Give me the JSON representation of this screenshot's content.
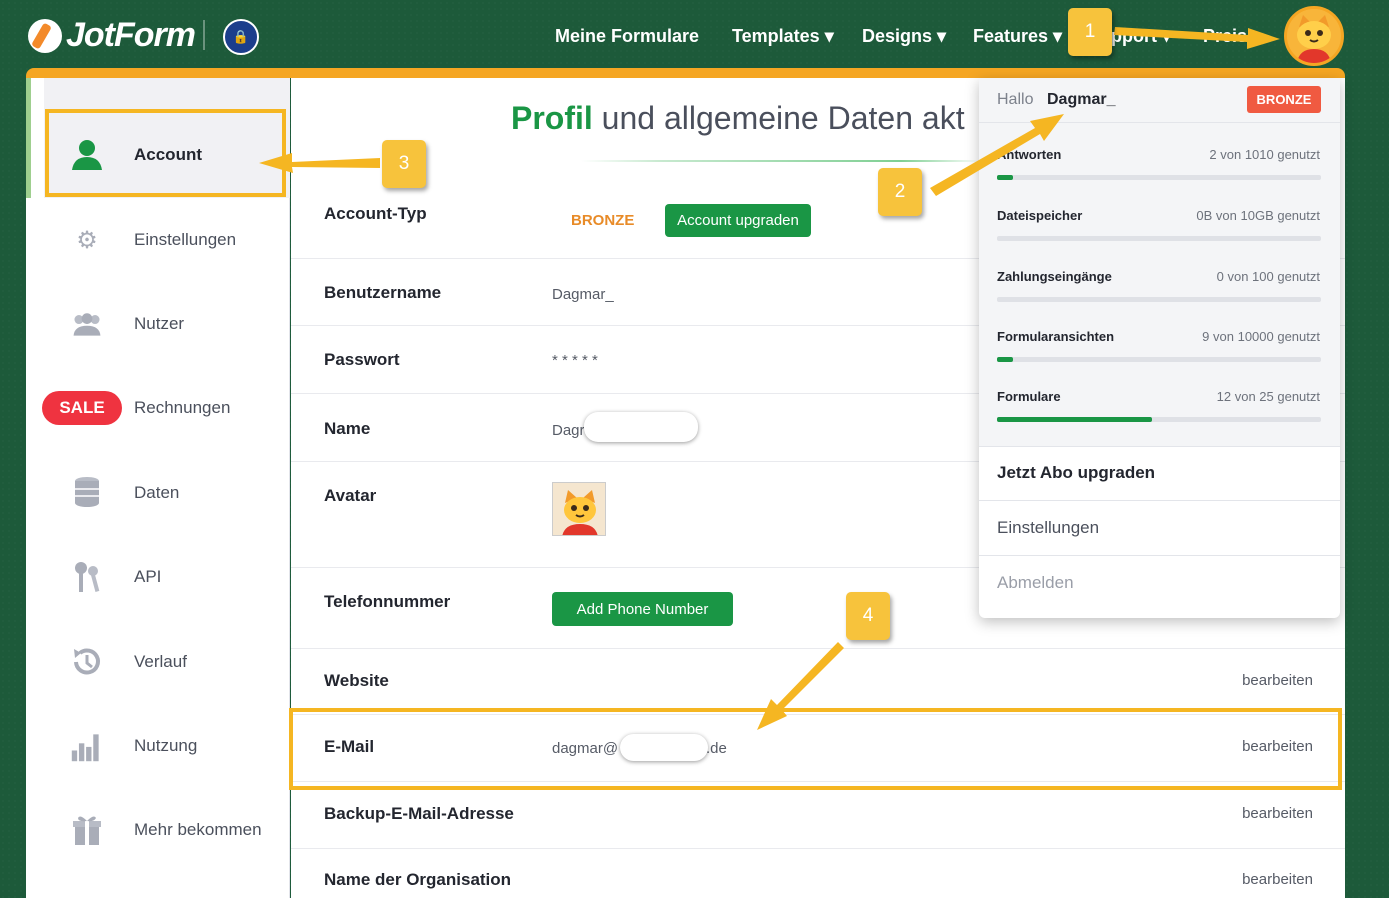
{
  "header": {
    "logo_text": "JotForm",
    "nav": [
      "Meine Formulare",
      "Templates ▾",
      "Designs ▾",
      "Features ▾",
      "Support ▾",
      "Preise"
    ]
  },
  "sidebar": {
    "items": [
      {
        "label": "Account",
        "icon": "user-icon",
        "active": true
      },
      {
        "label": "Einstellungen",
        "icon": "gears-icon"
      },
      {
        "label": "Nutzer",
        "icon": "users-icon"
      },
      {
        "label": "Rechnungen",
        "icon": "sale-icon",
        "badge": "SALE"
      },
      {
        "label": "Daten",
        "icon": "database-icon"
      },
      {
        "label": "API",
        "icon": "keys-icon"
      },
      {
        "label": "Verlauf",
        "icon": "history-icon"
      },
      {
        "label": "Nutzung",
        "icon": "bar-chart-icon"
      },
      {
        "label": "Mehr bekommen",
        "icon": "gift-icon"
      }
    ]
  },
  "main": {
    "title_highlight": "Profil",
    "title_rest": "und allgemeine Daten akt",
    "account_type_label": "Account-Typ",
    "account_type_value": "BRONZE",
    "upgrade_button": "Account upgraden",
    "username_label": "Benutzername",
    "username_value": "Dagmar_",
    "password_label": "Passwort",
    "password_value": "* * * * *",
    "name_label": "Name",
    "name_value": "Dagr",
    "avatar_label": "Avatar",
    "phone_label": "Telefonnummer",
    "phone_button": "Add Phone Number",
    "website_label": "Website",
    "email_label": "E-Mail",
    "email_value_start": "dagmar@",
    "email_value_end": ".de",
    "backup_email_label": "Backup-E-Mail-Adresse",
    "organisation_label": "Name der Organisation",
    "edit_label": "bearbeiten"
  },
  "dropdown": {
    "hello": "Hallo",
    "username": "Dagmar_",
    "badge": "BRONZE",
    "usage": [
      {
        "label": "Antworten",
        "count": "2 von 1010 genutzt",
        "fraction": 0.002
      },
      {
        "label": "Dateispeicher",
        "count": "0B von 10GB genutzt",
        "fraction": 0.0
      },
      {
        "label": "Zahlungseingänge",
        "count": "0 von 100 genutzt",
        "fraction": 0.0
      },
      {
        "label": "Formularansichten",
        "count": "9 von 10000 genutzt",
        "fraction": 0.001
      },
      {
        "label": "Formulare",
        "count": "12 von 25 genutzt",
        "fraction": 0.48
      }
    ],
    "upgrade_link": "Jetzt Abo upgraden",
    "settings_link": "Einstellungen",
    "logout_link": "Abmelden"
  },
  "annotations": {
    "steps": [
      "1",
      "2",
      "3",
      "4"
    ],
    "color": "#f5b622"
  },
  "colors": {
    "brand_green": "#1a9645",
    "background_green": "#1d5a3a",
    "accent_orange": "#f5a623",
    "badge_red": "#f05a41"
  }
}
